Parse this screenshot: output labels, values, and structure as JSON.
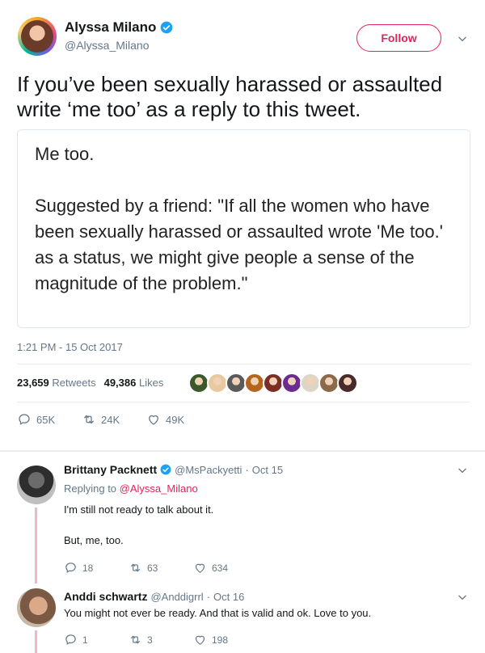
{
  "tweet": {
    "author_name": "Alyssa Milano",
    "author_handle": "@Alyssa_Milano",
    "follow_label": "Follow",
    "text": "If you’ve been sexually harassed or assaulted write ‘me too’ as a reply to this tweet.",
    "media_text": "Me too.\n\nSuggested by a friend: \"If all the women who have been sexually harassed or assaulted wrote 'Me too.' as a status, we might give people a sense of the magnitude of the problem.\"",
    "timestamp": "1:21 PM - 15 Oct 2017",
    "retweets_count": "23,659",
    "retweets_label": "Retweets",
    "likes_count": "49,386",
    "likes_label": "Likes",
    "reply_count": "65K",
    "retweet_action_count": "24K",
    "like_action_count": "49K",
    "liker_avatar_colors": [
      "#3a5a2a",
      "#e8c9a0",
      "#5a5a5a",
      "#b5651d",
      "#7b2d26",
      "#6c2c8f",
      "#ddd6c8",
      "#8a6a4a",
      "#4a2b2b"
    ]
  },
  "replies": [
    {
      "name": "Brittany Packnett",
      "handle": "@MsPackyetti",
      "sep": "·",
      "date": "Oct 15",
      "replying_prefix": "Replying to",
      "replying_to": "@Alyssa_Milano",
      "line1": "I'm still not ready to talk about it.",
      "line2": "But, me, too.",
      "reply_count": "18",
      "retweet_count": "63",
      "like_count": "634"
    },
    {
      "name": "Anddi schwartz",
      "handle": "@Anddigrrl",
      "sep": "·",
      "date": "Oct 16",
      "line1": "You might not ever be ready. And that is valid and ok. Love to you.",
      "reply_count": "1",
      "retweet_count": "3",
      "like_count": "198"
    }
  ],
  "colors": {
    "accent": "#e0245e",
    "muted": "#657786",
    "verified": "#1da1f2",
    "thread_line": "#f4b6c5"
  },
  "icons": [
    "verified-icon",
    "chevron-down-icon",
    "reply-icon",
    "retweet-icon",
    "like-icon"
  ]
}
